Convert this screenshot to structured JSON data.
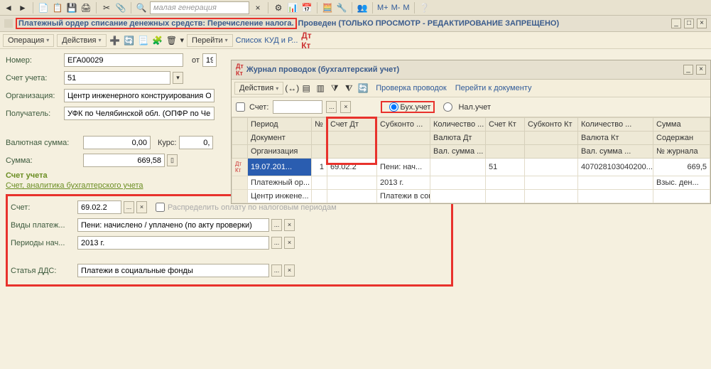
{
  "main_toolbar": {
    "search_placeholder": "малая генерация",
    "m_labels": [
      "M+",
      "M-",
      "M"
    ]
  },
  "doc": {
    "title_highlight": "Платежный ордер списание денежных средств: Перечисление налога.",
    "title_rest": "Проведен (ТОЛЬКО ПРОСМОТР - РЕДАКТИРОВАНИЕ ЗАПРЕЩЕНО)"
  },
  "doc_toolbar": {
    "operation": "Операция",
    "actions": "Действия",
    "go_to": "Перейти",
    "list": "Список",
    "kud": "КУД и Р..."
  },
  "form": {
    "number_lbl": "Номер:",
    "number": "ЕГА00029",
    "from_lbl": "от",
    "from": "19",
    "account_lbl": "Счет учета:",
    "account": "51",
    "org_lbl": "Организация:",
    "org": "Центр инженерного конструирования О",
    "recipient_lbl": "Получатель:",
    "recipient": "УФК по Челябинской обл. (ОПФР по Че",
    "fx_sum_lbl": "Валютная сумма:",
    "fx_sum": "0,00",
    "rate_lbl": "Курс:",
    "rate": "0,",
    "sum_lbl": "Сумма:",
    "sum": "669,58"
  },
  "account_section": {
    "title": "Счет учета",
    "subtitle": "Счет, аналитика бухгалтерского учета",
    "account_lbl": "Счет:",
    "account": "69.02.2",
    "distribute_lbl": "Распределить оплату по налоговым периодам",
    "payment_type_lbl": "Виды платеж...",
    "payment_type": "Пени: начислено / уплачено (по акту проверки)",
    "period_lbl": "Периоды нач...",
    "period": "2013 г.",
    "dds_lbl": "Статья ДДС:",
    "dds": "Платежи в социальные фонды"
  },
  "journal": {
    "title": "Журнал проводок (бухгалтерский учет)",
    "actions": "Действия",
    "check": "Проверка проводок",
    "goto_doc": "Перейти к документу",
    "filter_account_lbl": "Счет:",
    "radio_buh": "Бух.учет",
    "radio_nal": "Нал.учет",
    "headers": {
      "r1": [
        "",
        "Период",
        "№",
        "Счет Дт",
        "Субконто ...",
        "Количество ...",
        "Счет Кт",
        "Субконто Кт",
        "Количество ...",
        "Сумма"
      ],
      "r2": [
        "",
        "Документ",
        "",
        "",
        "",
        "Валюта Дт",
        "",
        "",
        "Валюта Кт",
        "Содержан"
      ],
      "r3": [
        "",
        "Организация",
        "",
        "",
        "",
        "Вал. сумма ...",
        "",
        "",
        "Вал. сумма ...",
        "№ журнала"
      ]
    },
    "rows": {
      "r1": [
        "",
        "19.07.201...",
        "1",
        "69.02.2",
        "Пени: нач...",
        "",
        "51",
        "",
        "407028103040200...",
        "669,5"
      ],
      "r2": [
        "",
        "Платежный ор...",
        "",
        "",
        "2013 г.",
        "",
        "",
        "",
        "",
        "Взыс. ден..."
      ],
      "r3": [
        "",
        "Центр инжене...",
        "",
        "",
        "Платежи в социа...",
        "",
        "",
        "",
        "",
        ""
      ]
    }
  }
}
